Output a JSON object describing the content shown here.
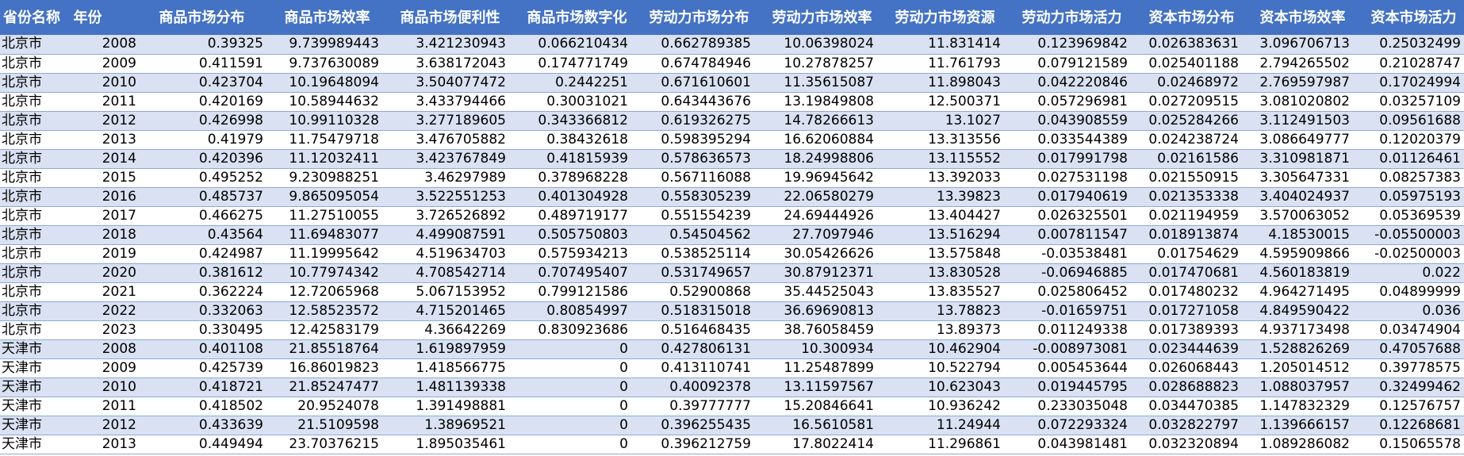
{
  "table": {
    "headers": [
      "省份名称",
      "年份",
      "商品市场分布",
      "商品市场效率",
      "商品市场便利性",
      "商品市场数字化",
      "劳动力市场分布",
      "劳动力市场效率",
      "劳动力市场资源",
      "劳动力市场活力",
      "资本市场分布",
      "资本市场效率",
      "资本市场活力"
    ],
    "rows": [
      [
        "北京市",
        "2008",
        "0.39325",
        "9.739989443",
        "3.421230943",
        "0.066210434",
        "0.662789385",
        "10.06398024",
        "11.831414",
        "0.123969842",
        "0.026383631",
        "3.096706713",
        "0.25032499"
      ],
      [
        "北京市",
        "2009",
        "0.411591",
        "9.737630089",
        "3.638172043",
        "0.174771749",
        "0.674784946",
        "10.27878257",
        "11.761793",
        "0.079121589",
        "0.025401188",
        "2.794265502",
        "0.21028747"
      ],
      [
        "北京市",
        "2010",
        "0.423704",
        "10.19648094",
        "3.504077472",
        "0.2442251",
        "0.671610601",
        "11.35615087",
        "11.898043",
        "0.042220846",
        "0.02468972",
        "2.769597987",
        "0.17024994"
      ],
      [
        "北京市",
        "2011",
        "0.420169",
        "10.58944632",
        "3.433794466",
        "0.30031021",
        "0.643443676",
        "13.19849808",
        "12.500371",
        "0.057296981",
        "0.027209515",
        "3.081020802",
        "0.03257109"
      ],
      [
        "北京市",
        "2012",
        "0.426998",
        "10.99110328",
        "3.277189605",
        "0.343366812",
        "0.619326275",
        "14.78266613",
        "13.1027",
        "0.043908559",
        "0.025284266",
        "3.112491503",
        "0.09561688"
      ],
      [
        "北京市",
        "2013",
        "0.41979",
        "11.75479718",
        "3.476705882",
        "0.38432618",
        "0.598395294",
        "16.62060884",
        "13.313556",
        "0.033544389",
        "0.024238724",
        "3.086649777",
        "0.12020379"
      ],
      [
        "北京市",
        "2014",
        "0.420396",
        "11.12032411",
        "3.423767849",
        "0.41815939",
        "0.578636573",
        "18.24998806",
        "13.115552",
        "0.017991798",
        "0.02161586",
        "3.310981871",
        "0.01126461"
      ],
      [
        "北京市",
        "2015",
        "0.495252",
        "9.230988251",
        "3.46297989",
        "0.378968228",
        "0.567116088",
        "19.96945642",
        "13.392033",
        "0.027531198",
        "0.021550915",
        "3.305647331",
        "0.08257383"
      ],
      [
        "北京市",
        "2016",
        "0.485737",
        "9.865095054",
        "3.522551253",
        "0.401304928",
        "0.558305239",
        "22.06580279",
        "13.39823",
        "0.017940619",
        "0.021353338",
        "3.404024937",
        "0.05975193"
      ],
      [
        "北京市",
        "2017",
        "0.466275",
        "11.27510055",
        "3.726526892",
        "0.489719177",
        "0.551554239",
        "24.69444926",
        "13.404427",
        "0.026325501",
        "0.021194959",
        "3.570063052",
        "0.05369539"
      ],
      [
        "北京市",
        "2018",
        "0.43564",
        "11.69483077",
        "4.499087591",
        "0.505750803",
        "0.54504562",
        "27.7097946",
        "13.516294",
        "0.007811547",
        "0.018913874",
        "4.18530015",
        "-0.05500003"
      ],
      [
        "北京市",
        "2019",
        "0.424987",
        "11.19995642",
        "4.519634703",
        "0.575934213",
        "0.538525114",
        "30.05426626",
        "13.575848",
        "-0.03538481",
        "0.01754629",
        "4.595909866",
        "-0.02500003"
      ],
      [
        "北京市",
        "2020",
        "0.381612",
        "10.77974342",
        "4.708542714",
        "0.707495407",
        "0.531749657",
        "30.87912371",
        "13.830528",
        "-0.06946885",
        "0.017470681",
        "4.560183819",
        "0.022"
      ],
      [
        "北京市",
        "2021",
        "0.362224",
        "12.72065968",
        "5.067153952",
        "0.799121586",
        "0.52900868",
        "35.44525043",
        "13.835527",
        "0.025806452",
        "0.017480232",
        "4.964271495",
        "0.04899999"
      ],
      [
        "北京市",
        "2022",
        "0.332063",
        "12.58523572",
        "4.715201465",
        "0.80854997",
        "0.518315018",
        "36.69690813",
        "13.78823",
        "-0.01659751",
        "0.017271058",
        "4.849590422",
        "0.036"
      ],
      [
        "北京市",
        "2023",
        "0.330495",
        "12.42583179",
        "4.36642269",
        "0.830923686",
        "0.516468435",
        "38.76058459",
        "13.89373",
        "0.011249338",
        "0.017389393",
        "4.937173498",
        "0.03474904"
      ],
      [
        "天津市",
        "2008",
        "0.401108",
        "21.85518764",
        "1.619897959",
        "0",
        "0.427806131",
        "10.300934",
        "10.462904",
        "-0.008973081",
        "0.023444639",
        "1.528826269",
        "0.47057688"
      ],
      [
        "天津市",
        "2009",
        "0.425739",
        "16.86019823",
        "1.418566775",
        "0",
        "0.413110741",
        "11.25487899",
        "10.522794",
        "0.005453644",
        "0.026068443",
        "1.205014512",
        "0.39778575"
      ],
      [
        "天津市",
        "2010",
        "0.418721",
        "21.85247477",
        "1.481139338",
        "0",
        "0.40092378",
        "13.11597567",
        "10.623043",
        "0.019445795",
        "0.028688823",
        "1.088037957",
        "0.32499462"
      ],
      [
        "天津市",
        "2011",
        "0.418502",
        "20.9524078",
        "1.391498881",
        "0",
        "0.39777777",
        "15.20846641",
        "10.936242",
        "0.233035048",
        "0.034470385",
        "1.147832329",
        "0.12576757"
      ],
      [
        "天津市",
        "2012",
        "0.433639",
        "21.5109598",
        "1.38969521",
        "0",
        "0.396255435",
        "16.5610581",
        "11.24944",
        "0.072293324",
        "0.032822797",
        "1.139666157",
        "0.12268681"
      ],
      [
        "天津市",
        "2013",
        "0.449494",
        "23.70376215",
        "1.895035461",
        "0",
        "0.396212759",
        "17.8022414",
        "11.296861",
        "0.043981481",
        "0.032320894",
        "1.089286082",
        "0.15065578"
      ]
    ]
  }
}
